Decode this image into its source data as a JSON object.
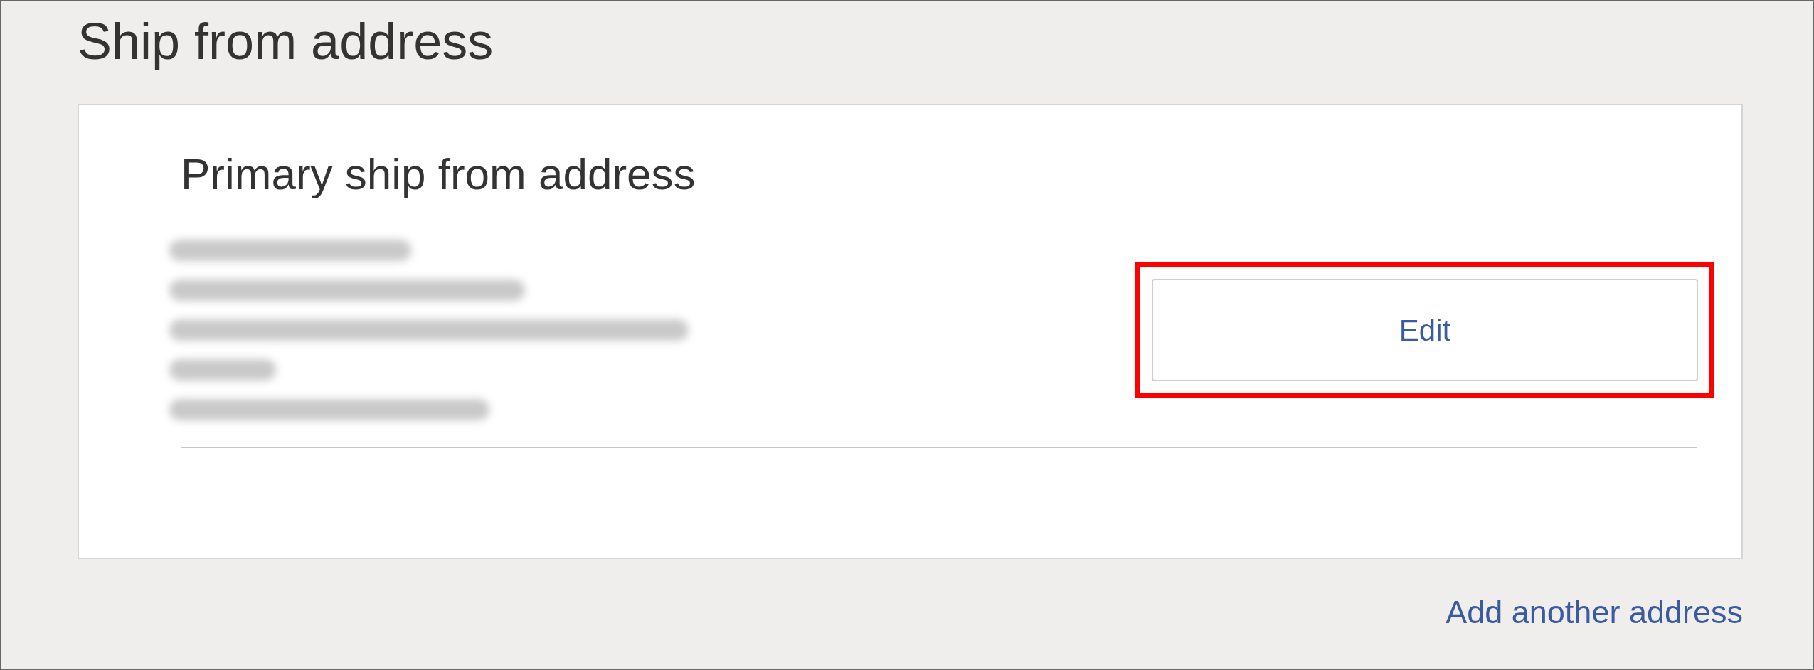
{
  "title": "Ship from address",
  "card": {
    "heading": "Primary ship from address",
    "edit_button": {
      "label": "Edit",
      "highlighted": true
    }
  },
  "add_link": "Add another address"
}
